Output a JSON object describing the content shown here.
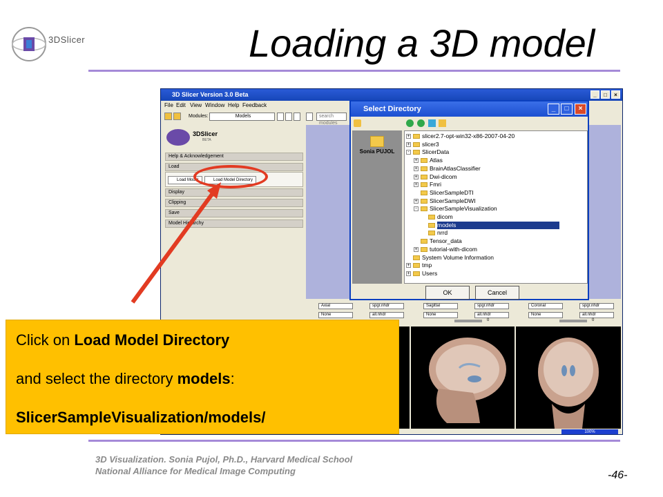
{
  "slide": {
    "title": "Loading a 3D model",
    "logo_text": "3DSlicer",
    "footer_line1": "3D Visualization. Sonia Pujol, Ph.D., Harvard Medical School",
    "footer_line2": "National Alliance for Medical Image Computing",
    "page_number": "-46-"
  },
  "slicer": {
    "window_title": "3D Slicer Version 3.0 Beta",
    "menu": [
      "File",
      "Edit",
      "View",
      "Window",
      "Help",
      "Feedback"
    ],
    "modules_label": "Modules:",
    "module_selected": "Models",
    "search_placeholder": "search modules",
    "logo": "3DSlicer",
    "logo_sub": "BETA",
    "sections": {
      "help": "Help & Acknowledgement",
      "load": "Load",
      "display": "Display",
      "clipping": "Clipping",
      "save": "Save",
      "hierarchy": "Model Hierarchy"
    },
    "load_model_button": "Load Model",
    "load_model_directory_button": "Load Model Directory",
    "views": [
      {
        "orientation": "Axial",
        "volume": "spgr.nhdr",
        "label": "None",
        "fg": "all.nhdr"
      },
      {
        "orientation": "Sagittal",
        "volume": "spgr.nhdr",
        "label": "None",
        "fg": "all.nhdr"
      },
      {
        "orientation": "Coronal",
        "volume": "spgr.nhdr",
        "label": "None",
        "fg": "all.nhdr"
      }
    ],
    "slider_value": "0",
    "progress_text": "100%"
  },
  "dialog": {
    "title": "Select Directory",
    "place": "Sonia PUJOL",
    "tree": [
      {
        "label": "slicer2.7-opt-win32-x86-2007-04-20",
        "depth": 0,
        "exp": "+"
      },
      {
        "label": "slicer3",
        "depth": 0,
        "exp": "+"
      },
      {
        "label": "SlicerData",
        "depth": 0,
        "exp": "-"
      },
      {
        "label": "Atlas",
        "depth": 1,
        "exp": "+"
      },
      {
        "label": "BrainAtlasClassifier",
        "depth": 1,
        "exp": "+"
      },
      {
        "label": "Dwi-dicom",
        "depth": 1,
        "exp": "+"
      },
      {
        "label": "Fmri",
        "depth": 1,
        "exp": "+"
      },
      {
        "label": "SlicerSampleDTI",
        "depth": 1,
        "exp": ""
      },
      {
        "label": "SlicerSampleDWI",
        "depth": 1,
        "exp": "+"
      },
      {
        "label": "SlicerSampleVisualization",
        "depth": 1,
        "exp": "-"
      },
      {
        "label": "dicom",
        "depth": 2,
        "exp": ""
      },
      {
        "label": "models",
        "depth": 2,
        "exp": "",
        "selected": true
      },
      {
        "label": "nrrd",
        "depth": 2,
        "exp": ""
      },
      {
        "label": "Tensor_data",
        "depth": 1,
        "exp": ""
      },
      {
        "label": "tutorial-with-dicom",
        "depth": 1,
        "exp": "+"
      },
      {
        "label": "System Volume Information",
        "depth": 0,
        "exp": ""
      },
      {
        "label": "tmp",
        "depth": 0,
        "exp": "+"
      },
      {
        "label": "Users",
        "depth": 0,
        "exp": "+"
      }
    ],
    "ok": "OK",
    "cancel": "Cancel"
  },
  "callout": {
    "line1_pre": "Click on ",
    "line1_bold": "Load Model Directory",
    "line2_pre": "and select the directory ",
    "line2_bold": "models",
    "line2_post": ":",
    "line3": "SlicerSampleVisualization/models/"
  },
  "colors": {
    "accent_rule": "#a58ad8",
    "callout_bg": "#ffc000",
    "highlight": "#e23b22"
  }
}
